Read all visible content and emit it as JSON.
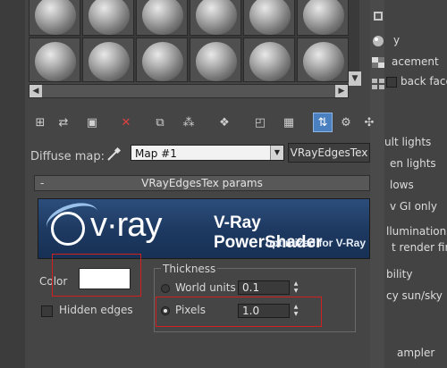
{
  "diffuse": {
    "label": "Diffuse map:",
    "map_name": "Map #1",
    "tex_type": "VRayEdgesTex"
  },
  "rollout": {
    "minus": "-",
    "title": "VRayEdgesTex params"
  },
  "banner": {
    "word": "v·ray",
    "tagline": "V-Ray PowerShader",
    "sub": "optimized for V-Ray"
  },
  "params": {
    "color_label": "Color",
    "color_value": "#ffffff",
    "hidden_edges_label": "Hidden edges",
    "thickness_label": "Thickness",
    "world_units_label": "World units",
    "world_units_value": "0.1",
    "pixels_label": "Pixels",
    "pixels_value": "1.0",
    "selected_mode": "Pixels"
  },
  "right_panel": {
    "items": [
      "y",
      "acement",
      "back face",
      "ult lights",
      "en lights",
      "lows",
      "v GI only",
      "llumination",
      "t render fir",
      "bility",
      "cy sun/sky",
      "ampler"
    ]
  },
  "icons": {
    "toolbar": [
      "get-material-icon",
      "put-to-scene-icon",
      "assign-to-selection-icon",
      "reset-map-icon",
      "copy-material-icon",
      "make-unique-icon",
      "put-to-library-icon",
      "material-id-icon",
      "show-in-viewport-icon",
      "show-end-result-icon",
      "go-to-parent-icon",
      "go-forward-icon",
      "pick-material-icon"
    ],
    "side": [
      "sample-type-icon",
      "backlight-icon",
      "background-icon",
      "uv-tiling-icon",
      "video-check-icon"
    ]
  }
}
